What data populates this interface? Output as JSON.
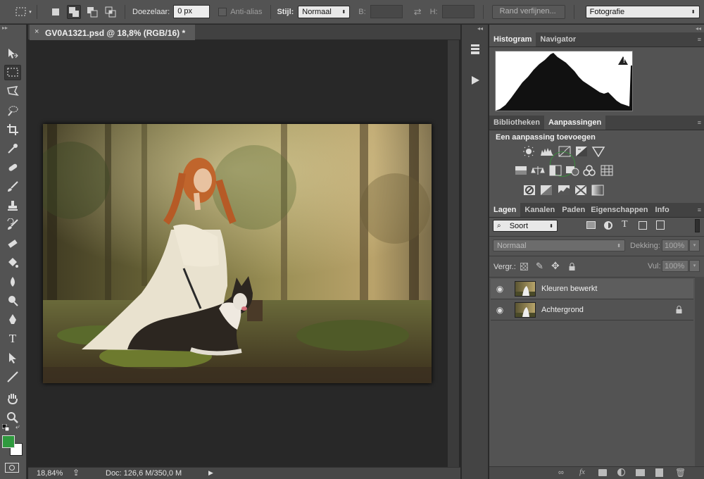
{
  "options_bar": {
    "feather_label": "Doezelaar:",
    "feather_value": "0 px",
    "antialias_label": "Anti-alias",
    "style_label": "Stijl:",
    "style_value": "Normaal",
    "width_label": "B:",
    "height_label": "H:",
    "refine_button": "Rand verfijnen...",
    "workspace_value": "Fotografie"
  },
  "document": {
    "tab_title": "GV0A1321.psd @ 18,8% (RGB/16) *",
    "close_glyph": "×"
  },
  "status_bar": {
    "zoom": "18,84%",
    "doc_info": "Doc: 126,6 M/350,0 M"
  },
  "histogram_panel": {
    "tabs": [
      "Histogram",
      "Navigator"
    ],
    "warning_glyph": "!"
  },
  "adjustments_panel": {
    "tabs": [
      "Bibliotheken",
      "Aanpassingen"
    ],
    "heading": "Een aanpassing toevoegen"
  },
  "layers_panel": {
    "tabs": [
      "Lagen",
      "Kanalen",
      "Paden",
      "Eigenschappen",
      "Info"
    ],
    "filter_value": "Soort",
    "blend_mode": "Normaal",
    "opacity_label": "Dekking:",
    "opacity_value": "100%",
    "lock_label": "Vergr.:",
    "fill_label": "Vul:",
    "fill_value": "100%",
    "layers": [
      {
        "name": "Kleuren bewerkt",
        "visible": true,
        "locked": false
      },
      {
        "name": "Achtergrond",
        "visible": true,
        "locked": true
      }
    ]
  },
  "colors": {
    "foreground": "#2f9a3e",
    "background": "#ffffff"
  }
}
